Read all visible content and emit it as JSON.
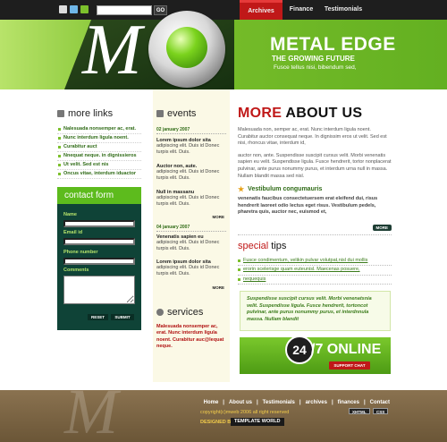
{
  "topbar": {
    "search_placeholder": "",
    "go_label": "GO",
    "nav": [
      {
        "label": "Archives",
        "active": true
      },
      {
        "label": "Finance",
        "active": false
      },
      {
        "label": "Testimonials",
        "active": false
      }
    ],
    "icons": [
      "home-icon",
      "mail-icon",
      "sitemap-icon"
    ]
  },
  "header": {
    "logo_letter": "M",
    "title": "METAL EDGE",
    "subtitle": "THE GROWING FUTURE",
    "description": "Fusce tellus nisi, bibendum sed,"
  },
  "more_links": {
    "title": "more links",
    "items": [
      "Nalesuada nonsemper ac, erat.",
      "Nunc interdum ligula noent.",
      "Curabitur auct",
      "Nnequat neque. in dignissieros",
      "Ut velit. Sed est nis",
      "Oncus vitae, interdum iduactor"
    ]
  },
  "contact_form": {
    "title": "contact form",
    "name_label": "Name",
    "email_label": "Email id",
    "phone_label": "Phone number",
    "comments_label": "Comments",
    "reset_label": "RESET",
    "submit_label": "SUBMIT"
  },
  "events": {
    "title": "events",
    "items": [
      {
        "date": "02 january 2007",
        "head": "Lorem ipsum dolor sita",
        "text": "adipiscing elit. Duis id Donec turpis elit. Duis."
      },
      {
        "date": "",
        "head": "Auctor non, aute.",
        "text": "adipiscing elit. Duis id Donec turpis elit. Duis."
      },
      {
        "date": "",
        "head": "Null in massanu",
        "text": "adipiscing elit. Duis id Donec turpis elit. Duis."
      },
      {
        "date": "04 january 2007",
        "head": "Venenatis sapien eu",
        "text": "adipiscing elit. Duis id Donec turpis elit. Duis."
      },
      {
        "date": "",
        "head": "Lorem ipsum dolor sita",
        "text": "adipiscing elit. Duis id Donec turpis elit. Duis."
      }
    ],
    "more_label": "MORE"
  },
  "services": {
    "title": "services",
    "text": "Malesuada nonsemper ac, erat. Nunc interdum ligula noent. Curabitur auc@lequat neque."
  },
  "about": {
    "title_red": "MORE",
    "title_rest": " ABOUT US",
    "para1": "Malesuada non, semper ac, erat. Nunc interdum ligula noent. Curabitur auctor consequat neque. In dignissim eros ut velit. Sed est nisi, rhoncus vitae, interdum id,",
    "para2": "auctor non, ante. Suspendisse suscipit cursus velit. Morbi venenatis sapien eu velit. Suspendisse ligula. Fusce hendrerit, tortor nonplacerat pulvinar, ante purus nonummy purus, et interdum urna null in massa. Nullam blandit massa sed nisl.",
    "subhead": "Vestibulum congumauris",
    "bold_para": "venenatis faucibus consectetuersem erat eleifend dui, risus hendrerit laoreet odio lectus eget risus. Vestibulum pedels, pharetra quis, auctor nec, euismod et,",
    "more_label": "MORE"
  },
  "special_tips": {
    "title_red": "special",
    "title_rest": " tips",
    "items": [
      "Fusce condimentum, velikin pulvar volutpat,nisl dui mollis",
      "erorin scelerisge quam euteunisl. Maecenas posuere,",
      "nequequis"
    ],
    "quote": "Suspendisse suscipit cursus velit. Morbi venenatsnia velit. Suspendisse ligula. Fusce hendrerit, tortoncot pulvinar, ante purus nonummy purus, et interdnnula massa. Nullam blandit"
  },
  "online": {
    "badge": "24",
    "text": "/7 ONLINE",
    "button": "SUPPORT CHAT"
  },
  "footer": {
    "links": [
      "Home",
      "|",
      "About us",
      "|",
      "Testimonials",
      "|",
      "archives",
      "|",
      "finances",
      "|",
      "Contact"
    ],
    "copyright": "copyright(c)mweb 2006 all right reserved",
    "designed_by": "DESIGNED BY",
    "template_world": "TEMPLATE WORLD",
    "badge1": "XHTML",
    "badge2": "CSS"
  },
  "colors": {
    "accent_green": "#7cc02c",
    "accent_red": "#c01818",
    "dark_green": "#0f4337",
    "footer_brown": "#7a6444"
  }
}
